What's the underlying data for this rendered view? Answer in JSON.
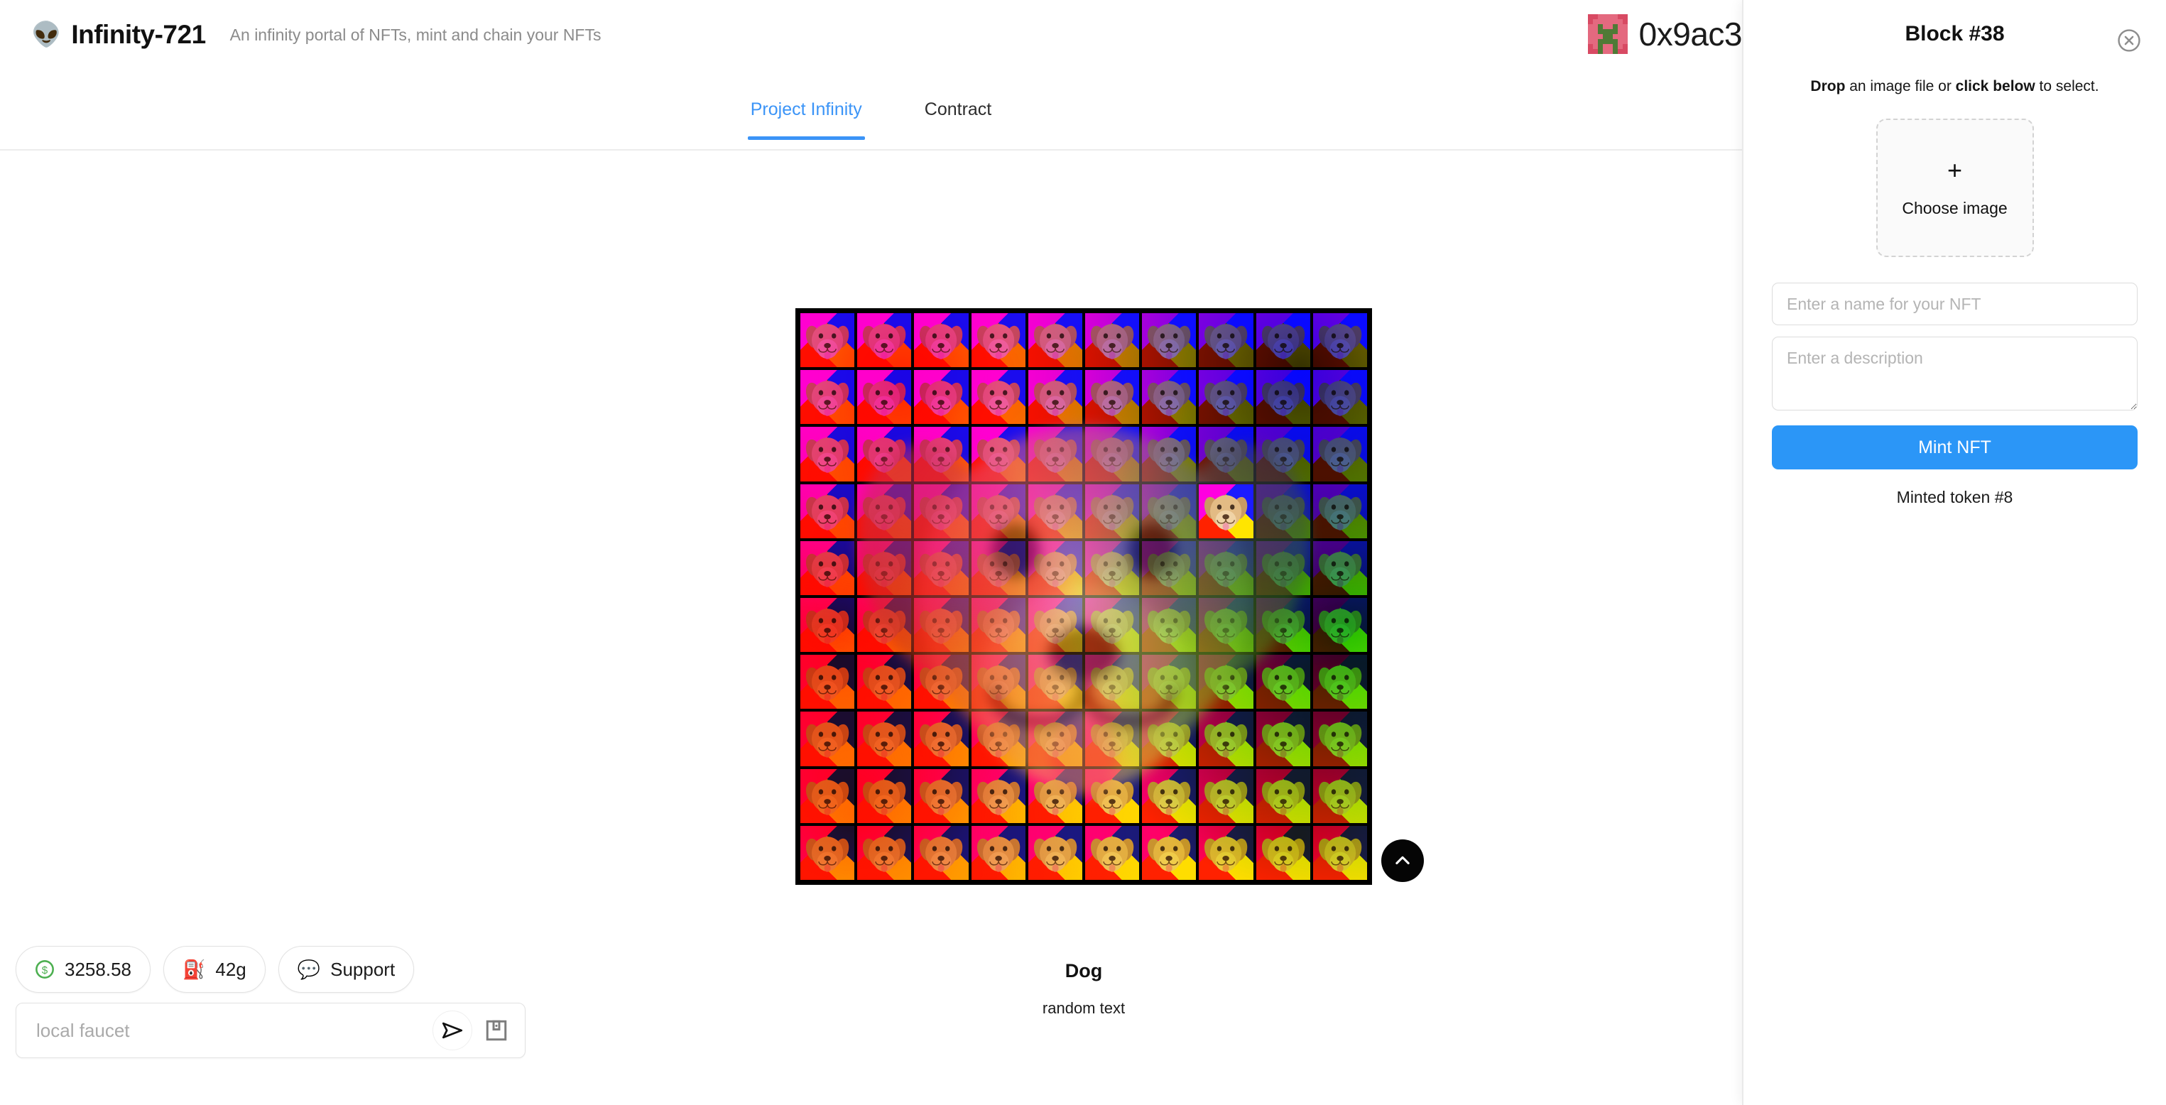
{
  "header": {
    "logo_icon": "alien-icon",
    "title": "Infinity-721",
    "tagline": "An infinity portal of NFTs, mint and chain your NFTs",
    "account_address": "0x9ac3"
  },
  "tabs": [
    {
      "label": "Project Infinity",
      "active": true
    },
    {
      "label": "Contract",
      "active": false
    }
  ],
  "artwork": {
    "title": "Dog",
    "description": "random text",
    "scroll_top_icon": "chevron-up-icon",
    "grid_columns": 10,
    "grid_rows": 10,
    "selected_cell_column": 8,
    "selected_cell_row": 4
  },
  "widgets": {
    "balance": {
      "icon": "dollar-icon",
      "value": "3258.58"
    },
    "gas": {
      "icon": "fuel-pump-icon",
      "value": "42g"
    },
    "support": {
      "icon": "chat-bubble-icon",
      "label": "Support"
    },
    "faucet": {
      "placeholder": "local faucet",
      "value": "",
      "send_icon": "send-icon",
      "save_icon": "floppy-disk-icon"
    }
  },
  "panel": {
    "title": "Block #38",
    "close_icon": "close-circle-icon",
    "drop_hint_bold_1": "Drop",
    "drop_hint_mid_1": " an image file or ",
    "drop_hint_bold_2": "click below",
    "drop_hint_mid_2": " to select.",
    "dropzone": {
      "plus": "+",
      "label": "Choose image"
    },
    "name_placeholder": "Enter a name for your NFT",
    "name_value": "",
    "description_placeholder": "Enter a description",
    "description_value": "",
    "mint_label": "Mint NFT",
    "mint_status": "Minted token #8"
  },
  "colors": {
    "accent_blue": "#2b96f7",
    "tab_active": "#3b94f7",
    "balance_green": "#4caf50",
    "panel_border": "#e9e9e9",
    "art_border": "#000000"
  }
}
